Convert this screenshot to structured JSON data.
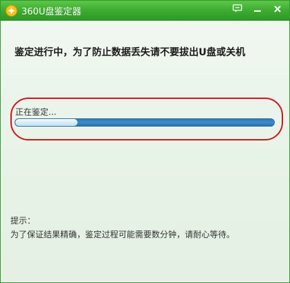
{
  "window": {
    "title": "360U盘鉴定器",
    "logo_icon": "360-logo-icon",
    "controls": [
      {
        "name": "feedback-button",
        "icon": "speech-bubble-icon"
      },
      {
        "name": "minimize-button",
        "icon": "minimize-icon"
      },
      {
        "name": "close-button",
        "icon": "close-icon"
      }
    ],
    "colors": {
      "titlebar": "#3aa92e",
      "highlight_border": "#d0141a",
      "progress": "#2f78b6"
    }
  },
  "main": {
    "headline": "鉴定进行中，为了防止数据丢失请不要拔出U盘或关机",
    "status": "正在鉴定...",
    "progress_fraction": 0.24
  },
  "tips": {
    "title": "提示：",
    "text": "为了保证结果精确，鉴定过程可能需要数分钟，请耐心等待。"
  }
}
